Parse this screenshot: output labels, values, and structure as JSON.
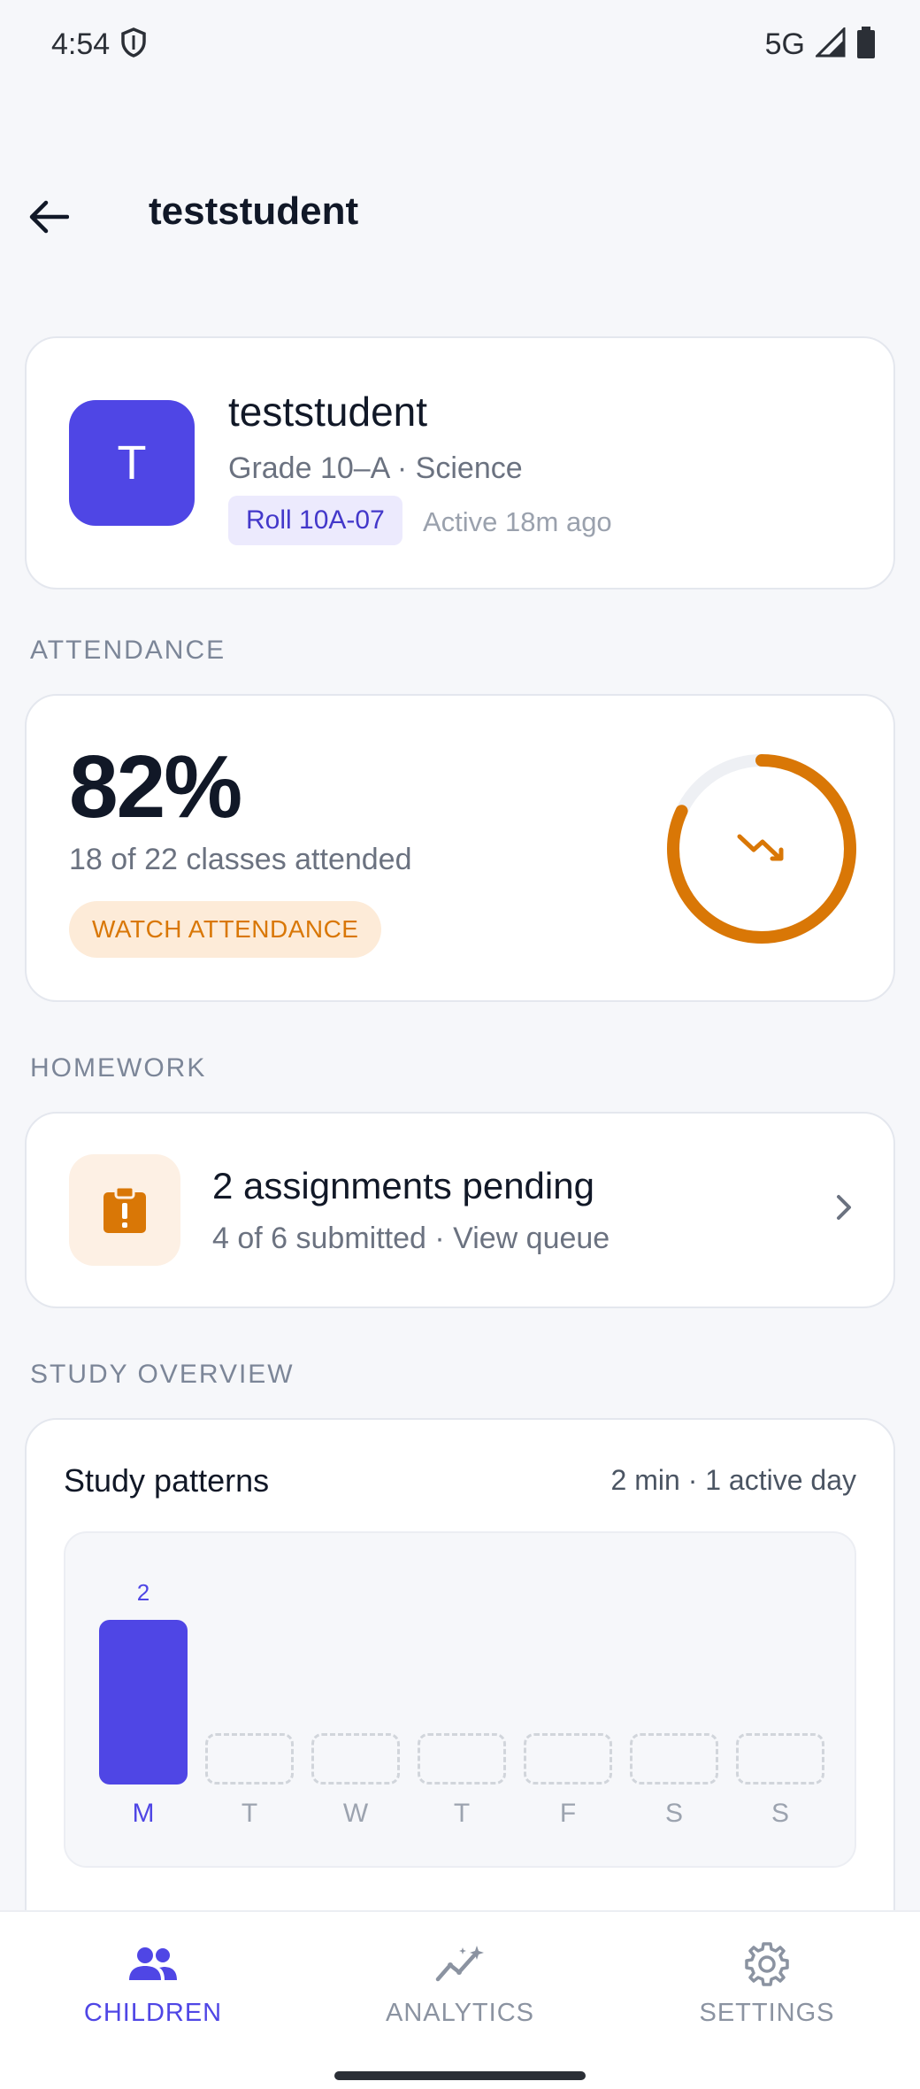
{
  "status_bar": {
    "time": "4:54",
    "network": "5G"
  },
  "app_bar": {
    "title": "teststudent"
  },
  "profile": {
    "avatar_letter": "T",
    "name": "teststudent",
    "grade": "Grade 10–A · Science",
    "roll": "Roll 10A-07",
    "active": "Active 18m ago"
  },
  "attendance": {
    "section_label": "ATTENDANCE",
    "percent": "82%",
    "percent_value": 82,
    "summary": "18 of 22 classes attended",
    "badge": "WATCH ATTENDANCE"
  },
  "homework": {
    "section_label": "HOMEWORK",
    "title": "2 assignments pending",
    "subtitle": "4 of 6 submitted · View queue"
  },
  "study": {
    "section_label": "STUDY OVERVIEW",
    "title": "Study patterns",
    "meta": "2 min · 1 active day"
  },
  "chart_data": {
    "type": "bar",
    "categories": [
      "M",
      "T",
      "W",
      "T",
      "F",
      "S",
      "S"
    ],
    "values": [
      2,
      0,
      0,
      0,
      0,
      0,
      0
    ],
    "value_labels": [
      "2",
      "",
      "",
      "",
      "",
      "",
      ""
    ],
    "highlight_index": 0
  },
  "bottom_nav": {
    "items": [
      {
        "label": "CHILDREN",
        "icon": "people-icon",
        "active": true
      },
      {
        "label": "ANALYTICS",
        "icon": "analytics-icon",
        "active": false
      },
      {
        "label": "SETTINGS",
        "icon": "gear-icon",
        "active": false
      }
    ]
  },
  "colors": {
    "accent": "#4f46e5",
    "warning": "#d97706",
    "background": "#f6f7fa"
  }
}
